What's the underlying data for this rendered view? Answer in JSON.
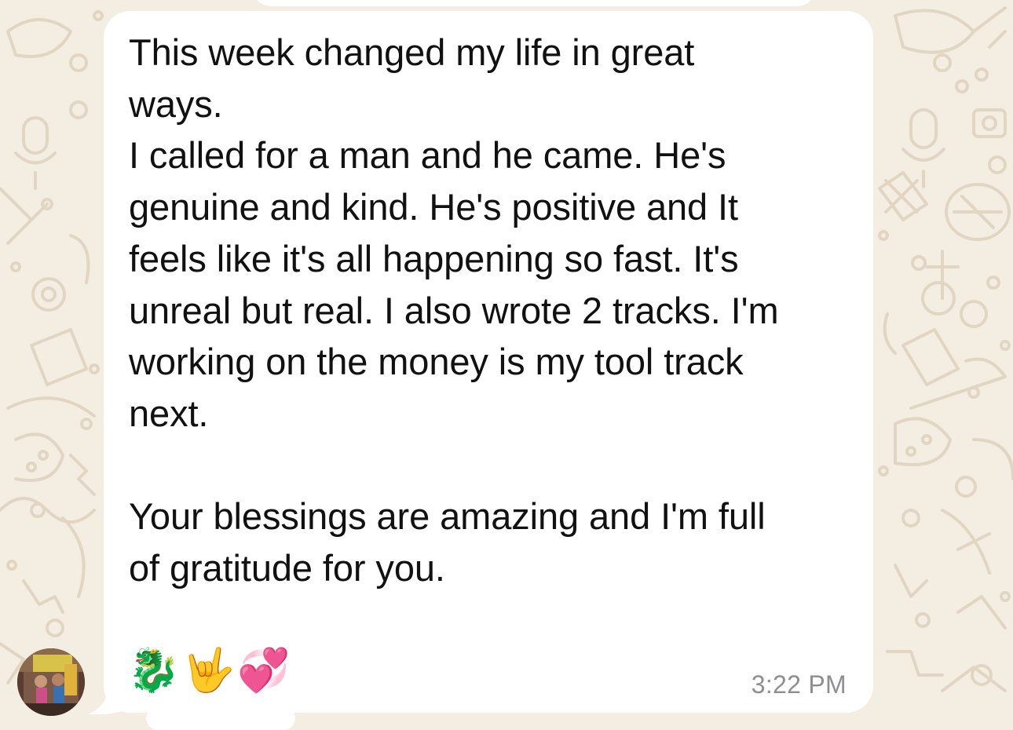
{
  "message": {
    "text": "This week changed my life in great\nways.\nI called for a man and he came. He's\ngenuine and kind. He's positive and It\nfeels like it's all happening so fast. It's\nunreal but real. I also wrote 2 tracks. I'm\nworking on the money is my tool track\nnext.\n\nYour blessings are amazing and I'm full\nof gratitude for you.",
    "time": "3:22 PM"
  },
  "reactions": [
    {
      "emoji": "🐉",
      "icon": "dragon-emoji"
    },
    {
      "emoji": "🤟",
      "icon": "love-you-gesture-emoji"
    },
    {
      "emoji": "💞",
      "icon": "revolving-hearts-emoji"
    }
  ],
  "colors": {
    "wallpaper": "#f3ede2",
    "wallpaper_pattern": "#e4d9c6",
    "bubble": "#ffffff",
    "text": "#111111",
    "timestamp": "#8e8e93"
  }
}
